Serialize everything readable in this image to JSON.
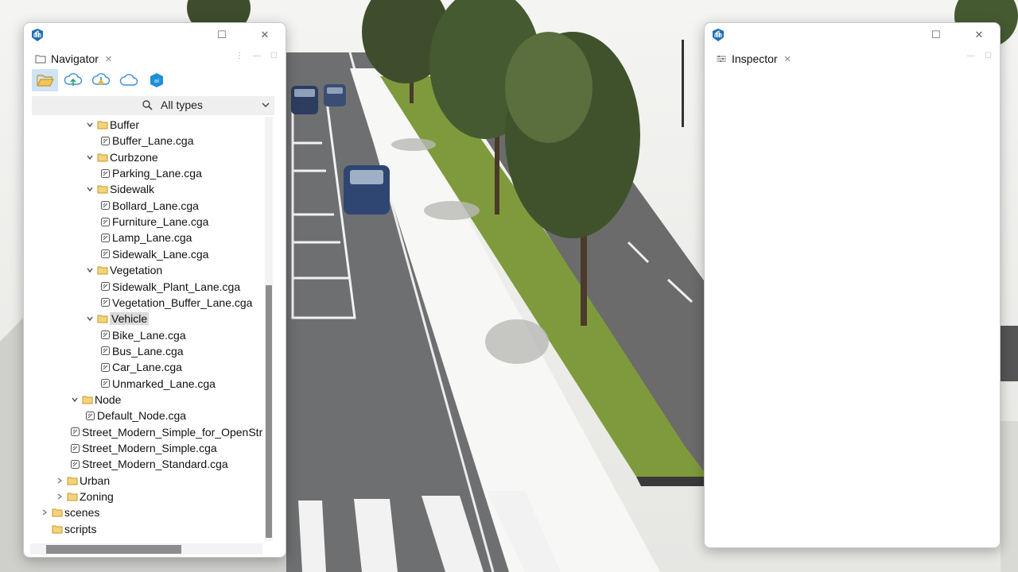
{
  "colors": {
    "accent": "#1f6fb5",
    "folder": "#e8b84a",
    "selection": "#dadada"
  },
  "navigator": {
    "tab_label": "Navigator",
    "toolbar": [
      {
        "icon": "open-folder-icon",
        "active": true
      },
      {
        "icon": "cloud-upload-icon",
        "active": false
      },
      {
        "icon": "cloud-share-icon",
        "active": false
      },
      {
        "icon": "cloud-icon",
        "active": false
      },
      {
        "icon": "ai-chip-icon",
        "active": false
      }
    ],
    "filter": {
      "value": "All types"
    },
    "tree": [
      {
        "level": 4,
        "type": "folder",
        "expanded": true,
        "label": "Buffer"
      },
      {
        "level": 5,
        "type": "file",
        "label": "Buffer_Lane.cga"
      },
      {
        "level": 4,
        "type": "folder",
        "expanded": true,
        "label": "Curbzone"
      },
      {
        "level": 5,
        "type": "file",
        "label": "Parking_Lane.cga"
      },
      {
        "level": 4,
        "type": "folder",
        "expanded": true,
        "label": "Sidewalk"
      },
      {
        "level": 5,
        "type": "file",
        "label": "Bollard_Lane.cga"
      },
      {
        "level": 5,
        "type": "file",
        "label": "Furniture_Lane.cga"
      },
      {
        "level": 5,
        "type": "file",
        "label": "Lamp_Lane.cga"
      },
      {
        "level": 5,
        "type": "file",
        "label": "Sidewalk_Lane.cga"
      },
      {
        "level": 4,
        "type": "folder",
        "expanded": true,
        "label": "Vegetation"
      },
      {
        "level": 5,
        "type": "file",
        "label": "Sidewalk_Plant_Lane.cga"
      },
      {
        "level": 5,
        "type": "file",
        "label": "Vegetation_Buffer_Lane.cga"
      },
      {
        "level": 4,
        "type": "folder",
        "expanded": true,
        "label": "Vehicle",
        "selected": true
      },
      {
        "level": 5,
        "type": "file",
        "label": "Bike_Lane.cga"
      },
      {
        "level": 5,
        "type": "file",
        "label": "Bus_Lane.cga"
      },
      {
        "level": 5,
        "type": "file",
        "label": "Car_Lane.cga"
      },
      {
        "level": 5,
        "type": "file",
        "label": "Unmarked_Lane.cga"
      },
      {
        "level": 3,
        "type": "folder",
        "expanded": true,
        "label": "Node"
      },
      {
        "level": 4,
        "type": "file",
        "label": "Default_Node.cga"
      },
      {
        "level": 3,
        "type": "file",
        "label": "Street_Modern_Simple_for_OpenStreetMap.cga"
      },
      {
        "level": 3,
        "type": "file",
        "label": "Street_Modern_Simple.cga"
      },
      {
        "level": 3,
        "type": "file",
        "label": "Street_Modern_Standard.cga"
      },
      {
        "level": 2,
        "type": "folder",
        "expanded": false,
        "label": "Urban"
      },
      {
        "level": 2,
        "type": "folder",
        "expanded": false,
        "label": "Zoning"
      },
      {
        "level": 1,
        "type": "folder",
        "expanded": false,
        "label": "scenes"
      },
      {
        "level": 1,
        "type": "folder",
        "expanded": null,
        "label": "scripts"
      }
    ]
  },
  "inspector": {
    "tab_label": "Inspector"
  }
}
